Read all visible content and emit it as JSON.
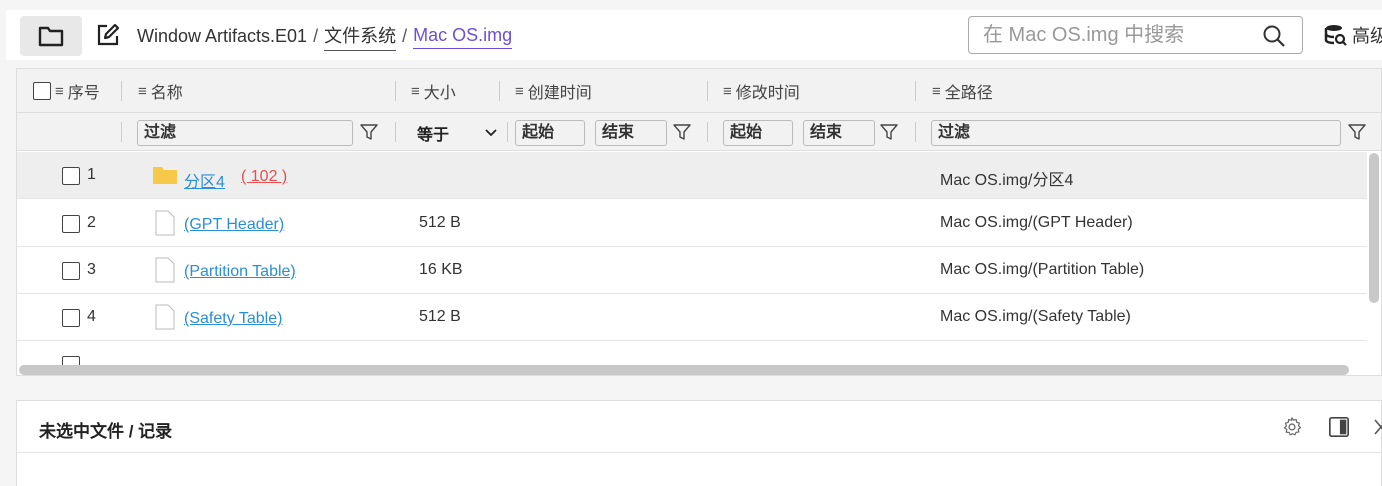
{
  "toolbar": {
    "breadcrumb": {
      "root": "Window Artifacts.E01",
      "sep1": "/",
      "level1": "文件系统",
      "sep2": "/",
      "current": "Mac OS.img"
    },
    "search_placeholder": "在 Mac OS.img 中搜索",
    "advanced_search_label": "高级"
  },
  "table": {
    "columns": {
      "index": "序号",
      "name": "名称",
      "size": "大小",
      "created": "创建时间",
      "modified": "修改时间",
      "full_path": "全路径"
    },
    "filters": {
      "name_placeholder": "过滤",
      "size_operator": "等于",
      "created_start": "起始",
      "created_end": "结束",
      "modified_start": "起始",
      "modified_end": "结束",
      "path_placeholder": "过滤"
    },
    "rows": [
      {
        "index": "1",
        "name": "分区4",
        "count": "( 102 )",
        "size": "",
        "path": "Mac OS.img/分区4",
        "type": "folder",
        "selected": true
      },
      {
        "index": "2",
        "name": "(GPT Header)",
        "count": "",
        "size": "512 B",
        "path": "Mac OS.img/(GPT Header)",
        "type": "file",
        "selected": false
      },
      {
        "index": "3",
        "name": "(Partition Table)",
        "count": "",
        "size": "16 KB",
        "path": "Mac OS.img/(Partition Table)",
        "type": "file",
        "selected": false
      },
      {
        "index": "4",
        "name": "(Safety Table)",
        "count": "",
        "size": "512 B",
        "path": "Mac OS.img/(Safety Table)",
        "type": "file",
        "selected": false
      }
    ]
  },
  "details": {
    "title": "未选中文件 / 记录"
  },
  "colors": {
    "accent": "#6c4fd8",
    "link": "#2a8ed8",
    "count": "#e05050",
    "folder": "#f7c948"
  }
}
